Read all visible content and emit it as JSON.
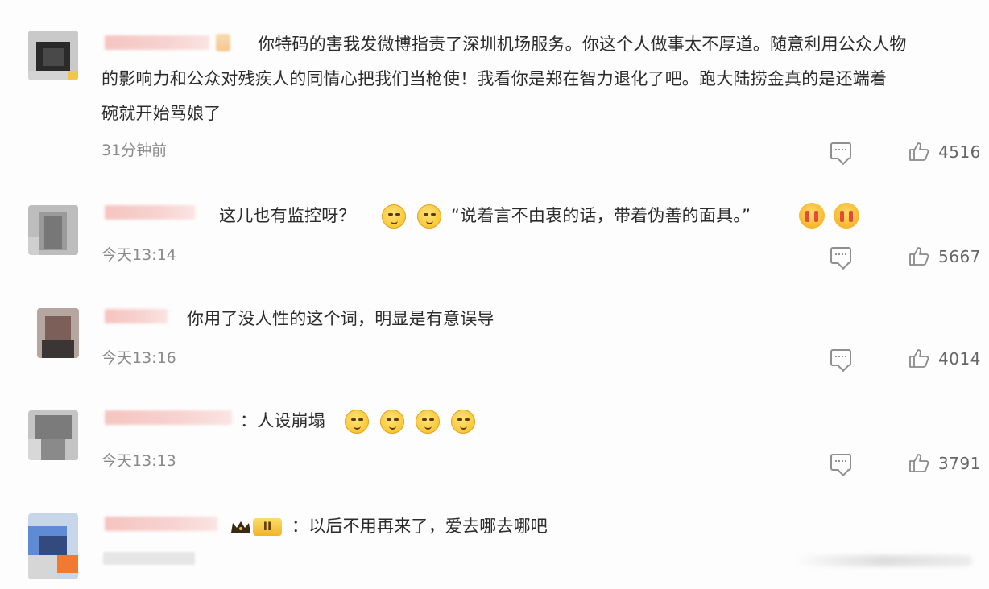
{
  "comments": [
    {
      "text_lines": [
        "你特码的害我发微博指责了深圳机场服务。你这个人做事太不厚道。随意利用公众人物",
        "的影响力和公众对残疾人的同情心把我们当枪使！我看你是郑在智力退化了吧。跑大陆捞金真的是还端着",
        "碗就开始骂娘了"
      ],
      "time": "31分钟前",
      "likes": "4516"
    },
    {
      "text_part1": "这儿也有监控呀？",
      "text_part2": "“说着言不由衷的话，带着伪善的面具。”",
      "time": "今天13:14",
      "likes": "5667"
    },
    {
      "text": "你用了没人性的这个词，明显是有意误导",
      "time": "今天13:16",
      "likes": "4014"
    },
    {
      "text": "：人设崩塌",
      "time": "今天13:13",
      "likes": "3791"
    },
    {
      "badge": "II",
      "text": "：以后不用再来了，爱去哪去哪吧"
    }
  ],
  "icons": {
    "reply": "comment-icon",
    "like": "thumbs-up-icon",
    "emoji": "doge-emoji",
    "cry": "crying-emoji",
    "crown": "crown-icon"
  },
  "colors": {
    "text": "#2b2b2b",
    "muted": "#8a8a8a",
    "name_blur": "#f5c4c0",
    "emoji": "#f9c634"
  }
}
